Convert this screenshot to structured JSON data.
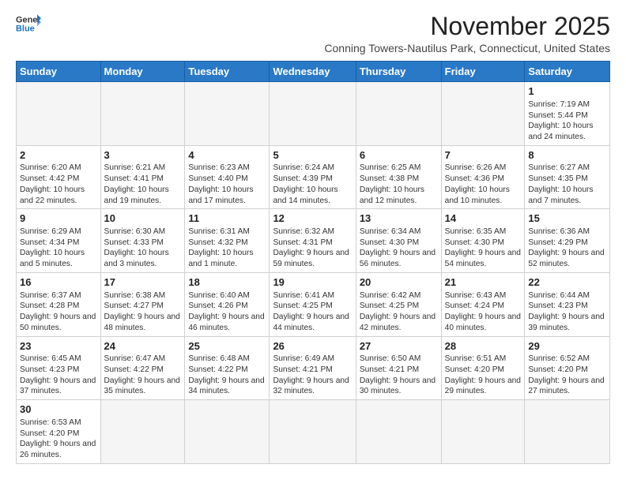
{
  "header": {
    "logo_line1": "General",
    "logo_line2": "Blue",
    "month": "November 2025",
    "location": "Conning Towers-Nautilus Park, Connecticut, United States"
  },
  "weekdays": [
    "Sunday",
    "Monday",
    "Tuesday",
    "Wednesday",
    "Thursday",
    "Friday",
    "Saturday"
  ],
  "weeks": [
    [
      {
        "num": "",
        "info": ""
      },
      {
        "num": "",
        "info": ""
      },
      {
        "num": "",
        "info": ""
      },
      {
        "num": "",
        "info": ""
      },
      {
        "num": "",
        "info": ""
      },
      {
        "num": "",
        "info": ""
      },
      {
        "num": "1",
        "info": "Sunrise: 7:19 AM\nSunset: 5:44 PM\nDaylight: 10 hours and 24 minutes."
      }
    ],
    [
      {
        "num": "2",
        "info": "Sunrise: 6:20 AM\nSunset: 4:42 PM\nDaylight: 10 hours and 22 minutes."
      },
      {
        "num": "3",
        "info": "Sunrise: 6:21 AM\nSunset: 4:41 PM\nDaylight: 10 hours and 19 minutes."
      },
      {
        "num": "4",
        "info": "Sunrise: 6:23 AM\nSunset: 4:40 PM\nDaylight: 10 hours and 17 minutes."
      },
      {
        "num": "5",
        "info": "Sunrise: 6:24 AM\nSunset: 4:39 PM\nDaylight: 10 hours and 14 minutes."
      },
      {
        "num": "6",
        "info": "Sunrise: 6:25 AM\nSunset: 4:38 PM\nDaylight: 10 hours and 12 minutes."
      },
      {
        "num": "7",
        "info": "Sunrise: 6:26 AM\nSunset: 4:36 PM\nDaylight: 10 hours and 10 minutes."
      },
      {
        "num": "8",
        "info": "Sunrise: 6:27 AM\nSunset: 4:35 PM\nDaylight: 10 hours and 7 minutes."
      }
    ],
    [
      {
        "num": "9",
        "info": "Sunrise: 6:29 AM\nSunset: 4:34 PM\nDaylight: 10 hours and 5 minutes."
      },
      {
        "num": "10",
        "info": "Sunrise: 6:30 AM\nSunset: 4:33 PM\nDaylight: 10 hours and 3 minutes."
      },
      {
        "num": "11",
        "info": "Sunrise: 6:31 AM\nSunset: 4:32 PM\nDaylight: 10 hours and 1 minute."
      },
      {
        "num": "12",
        "info": "Sunrise: 6:32 AM\nSunset: 4:31 PM\nDaylight: 9 hours and 59 minutes."
      },
      {
        "num": "13",
        "info": "Sunrise: 6:34 AM\nSunset: 4:30 PM\nDaylight: 9 hours and 56 minutes."
      },
      {
        "num": "14",
        "info": "Sunrise: 6:35 AM\nSunset: 4:30 PM\nDaylight: 9 hours and 54 minutes."
      },
      {
        "num": "15",
        "info": "Sunrise: 6:36 AM\nSunset: 4:29 PM\nDaylight: 9 hours and 52 minutes."
      }
    ],
    [
      {
        "num": "16",
        "info": "Sunrise: 6:37 AM\nSunset: 4:28 PM\nDaylight: 9 hours and 50 minutes."
      },
      {
        "num": "17",
        "info": "Sunrise: 6:38 AM\nSunset: 4:27 PM\nDaylight: 9 hours and 48 minutes."
      },
      {
        "num": "18",
        "info": "Sunrise: 6:40 AM\nSunset: 4:26 PM\nDaylight: 9 hours and 46 minutes."
      },
      {
        "num": "19",
        "info": "Sunrise: 6:41 AM\nSunset: 4:25 PM\nDaylight: 9 hours and 44 minutes."
      },
      {
        "num": "20",
        "info": "Sunrise: 6:42 AM\nSunset: 4:25 PM\nDaylight: 9 hours and 42 minutes."
      },
      {
        "num": "21",
        "info": "Sunrise: 6:43 AM\nSunset: 4:24 PM\nDaylight: 9 hours and 40 minutes."
      },
      {
        "num": "22",
        "info": "Sunrise: 6:44 AM\nSunset: 4:23 PM\nDaylight: 9 hours and 39 minutes."
      }
    ],
    [
      {
        "num": "23",
        "info": "Sunrise: 6:45 AM\nSunset: 4:23 PM\nDaylight: 9 hours and 37 minutes."
      },
      {
        "num": "24",
        "info": "Sunrise: 6:47 AM\nSunset: 4:22 PM\nDaylight: 9 hours and 35 minutes."
      },
      {
        "num": "25",
        "info": "Sunrise: 6:48 AM\nSunset: 4:22 PM\nDaylight: 9 hours and 34 minutes."
      },
      {
        "num": "26",
        "info": "Sunrise: 6:49 AM\nSunset: 4:21 PM\nDaylight: 9 hours and 32 minutes."
      },
      {
        "num": "27",
        "info": "Sunrise: 6:50 AM\nSunset: 4:21 PM\nDaylight: 9 hours and 30 minutes."
      },
      {
        "num": "28",
        "info": "Sunrise: 6:51 AM\nSunset: 4:20 PM\nDaylight: 9 hours and 29 minutes."
      },
      {
        "num": "29",
        "info": "Sunrise: 6:52 AM\nSunset: 4:20 PM\nDaylight: 9 hours and 27 minutes."
      }
    ],
    [
      {
        "num": "30",
        "info": "Sunrise: 6:53 AM\nSunset: 4:20 PM\nDaylight: 9 hours and 26 minutes."
      },
      {
        "num": "",
        "info": ""
      },
      {
        "num": "",
        "info": ""
      },
      {
        "num": "",
        "info": ""
      },
      {
        "num": "",
        "info": ""
      },
      {
        "num": "",
        "info": ""
      },
      {
        "num": "",
        "info": ""
      }
    ]
  ]
}
